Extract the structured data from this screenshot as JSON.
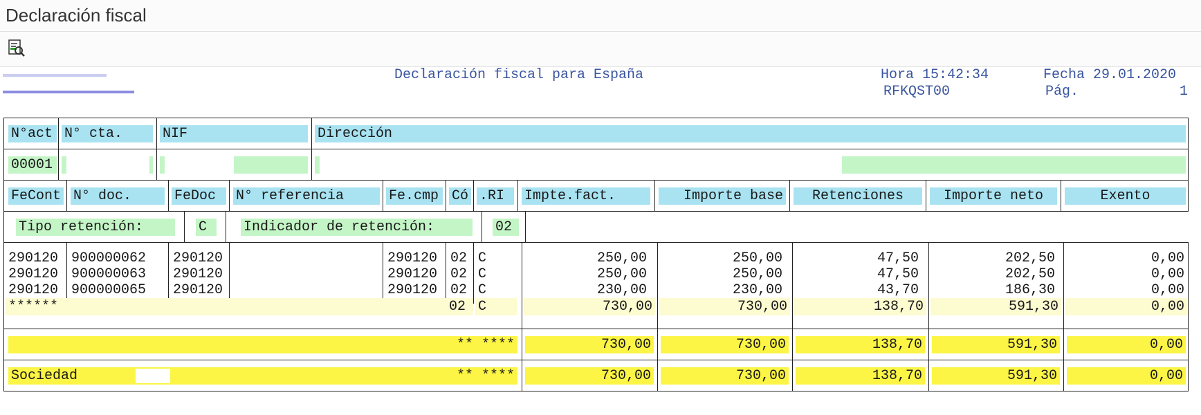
{
  "window": {
    "title": "Declaración fiscal"
  },
  "toolbar": {
    "icon": "find-document-icon"
  },
  "report": {
    "title": "Declaración fiscal para España",
    "hora_label": "Hora",
    "hora": "15:42:34",
    "fecha_label": "Fecha",
    "fecha": "29.01.2020",
    "program": "RFKQST00",
    "pag_label": "Pág.",
    "pag": "1"
  },
  "vendor_header": [
    "N°act",
    "N° cta.",
    "NIF",
    "Dirección"
  ],
  "vendor_row": {
    "nact": "00001"
  },
  "item_header": [
    "FeCont",
    "N° doc.",
    "FeDoc",
    "N° referencia",
    "Fe.cmp",
    "Có",
    ".RI",
    "Impte.fact.",
    "Importe base",
    "Retenciones",
    "Importe neto",
    "Exento"
  ],
  "retention": {
    "tipo_label": "Tipo retención:",
    "tipo": "C",
    "indicador_label": "Indicador de retención:",
    "indicador": "02"
  },
  "items": [
    {
      "fecont": "290120",
      "doc": "900000062",
      "fedoc": "290120",
      "fecmp": "290120",
      "co": "02",
      "ri": "C",
      "impte": "250,00",
      "base": "250,00",
      "ret": "47,50",
      "neto": "202,50",
      "exento": "0,00"
    },
    {
      "fecont": "290120",
      "doc": "900000063",
      "fedoc": "290120",
      "fecmp": "290120",
      "co": "02",
      "ri": "C",
      "impte": "250,00",
      "base": "250,00",
      "ret": "47,50",
      "neto": "202,50",
      "exento": "0,00"
    },
    {
      "fecont": "290120",
      "doc": "900000065",
      "fedoc": "290120",
      "fecmp": "290120",
      "co": "02",
      "ri": "C",
      "impte": "230,00",
      "base": "230,00",
      "ret": "43,70",
      "neto": "186,30",
      "exento": "0,00"
    }
  ],
  "subtotal": {
    "marker": "******",
    "co": "02",
    "ri": "C",
    "impte": "730,00",
    "base": "730,00",
    "ret": "138,70",
    "neto": "591,30",
    "exento": "0,00"
  },
  "total": {
    "marker": "** ****",
    "impte": "730,00",
    "base": "730,00",
    "ret": "138,70",
    "neto": "591,30",
    "exento": "0,00"
  },
  "sociedad": {
    "label": "Sociedad",
    "marker": "** ****",
    "impte": "730,00",
    "base": "730,00",
    "ret": "138,70",
    "neto": "591,30",
    "exento": "0,00"
  }
}
